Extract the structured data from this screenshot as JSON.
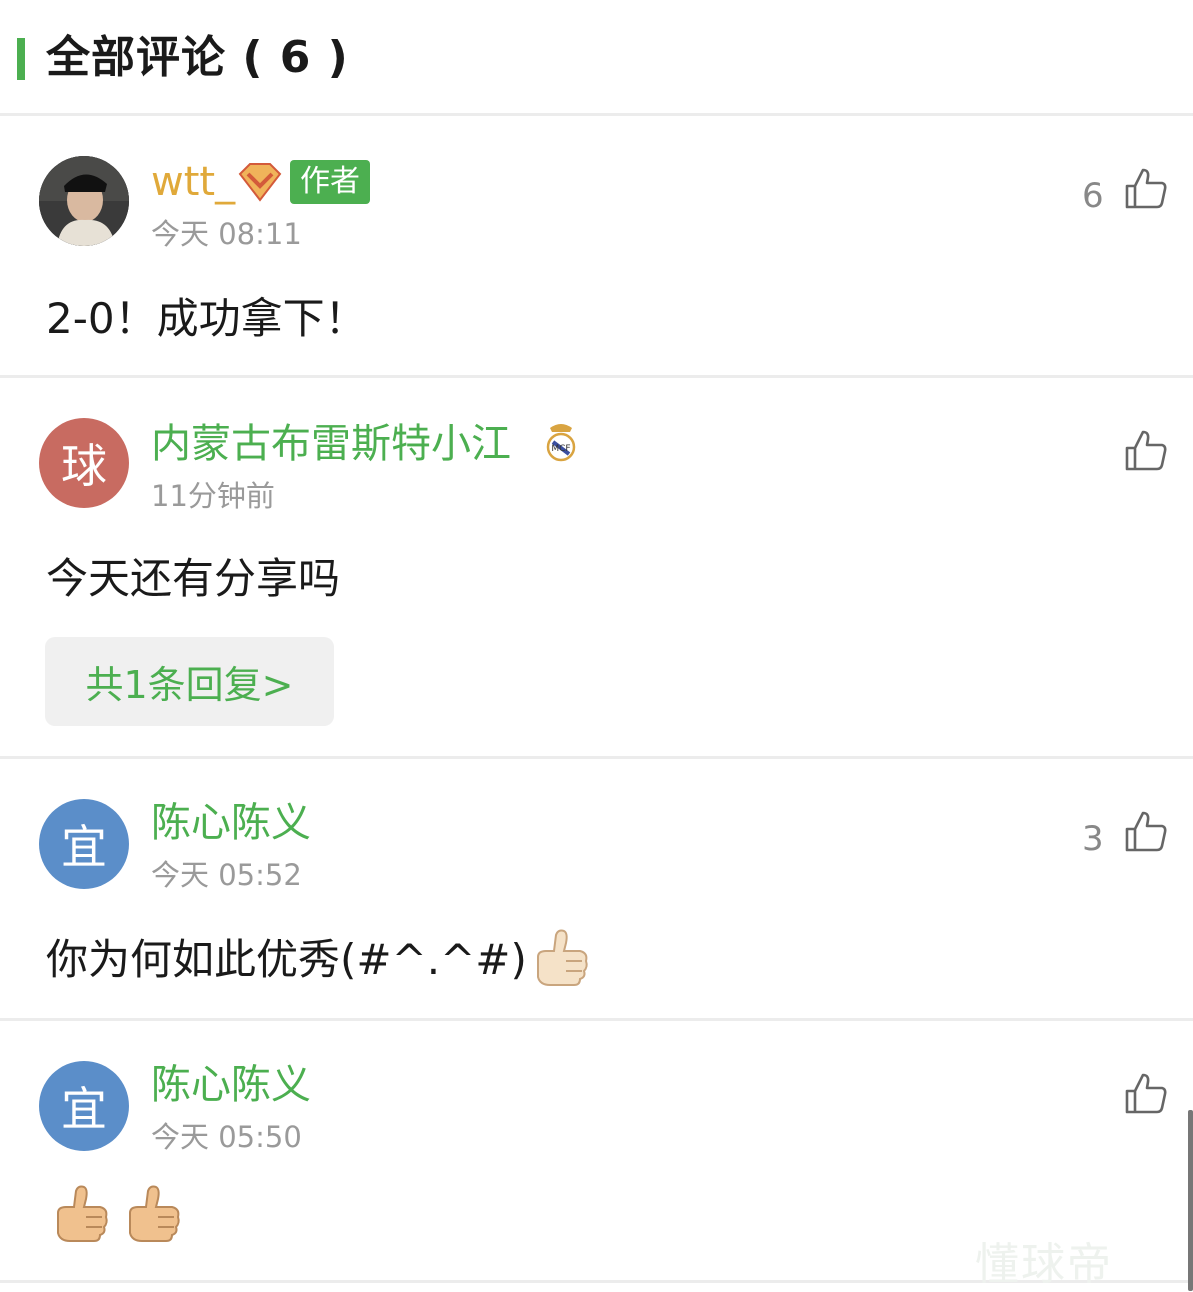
{
  "header": {
    "title": "全部评论 ( 6 )"
  },
  "comments": [
    {
      "username": "wtt_",
      "badge": "作者",
      "time": "今天 08:11",
      "text": "2-0！成功拿下！",
      "likes": "6",
      "avatar_icon": "user-photo-avatar",
      "level_icon": "diamond-vip-icon"
    },
    {
      "username": "内蒙古布雷斯特小江",
      "time": "11分钟前",
      "text": "今天还有分享吗",
      "likes": "",
      "avatar_text": "球",
      "avatar_color": "#c86b61",
      "team_icon": "real-madrid-crest-icon",
      "reply_button": "共1条回复>"
    },
    {
      "username": "陈心陈义",
      "time": "今天 05:52",
      "text": "你为何如此优秀(#^.^#)",
      "likes": "3",
      "avatar_text": "宜",
      "avatar_color": "#5b8ec9",
      "emoji": "thumbs-up-emoji"
    },
    {
      "username": "陈心陈义",
      "time": "今天 05:50",
      "text": "",
      "likes": "",
      "avatar_text": "宜",
      "avatar_color": "#5b8ec9",
      "emoji": "thumbs-up-emoji"
    }
  ],
  "colors": {
    "accent": "#4caf50",
    "author_name": "#e0a93a",
    "muted": "#9a9a9a"
  },
  "watermark": "懂球帝"
}
